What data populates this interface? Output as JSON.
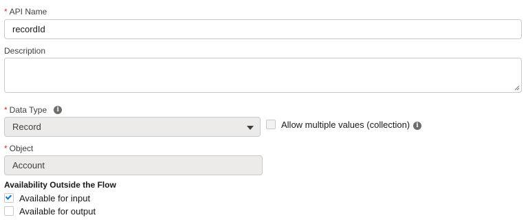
{
  "api_name": {
    "label": "API Name",
    "required_mark": "*",
    "value": "recordId"
  },
  "description": {
    "label": "Description",
    "value": ""
  },
  "data_type": {
    "label": "Data Type",
    "required_mark": "*",
    "info_icon": "info-icon",
    "selected": "Record"
  },
  "collection": {
    "label": "Allow multiple values (collection)",
    "checked": false,
    "info_icon": "info-icon"
  },
  "object": {
    "label": "Object",
    "required_mark": "*",
    "value": "Account"
  },
  "availability": {
    "title": "Availability Outside the Flow",
    "input": {
      "label": "Available for input",
      "checked": true
    },
    "output": {
      "label": "Available for output",
      "checked": false
    }
  },
  "colors": {
    "required": "#c23934",
    "check": "#0176d3",
    "disabled_bg": "#ecebea"
  }
}
